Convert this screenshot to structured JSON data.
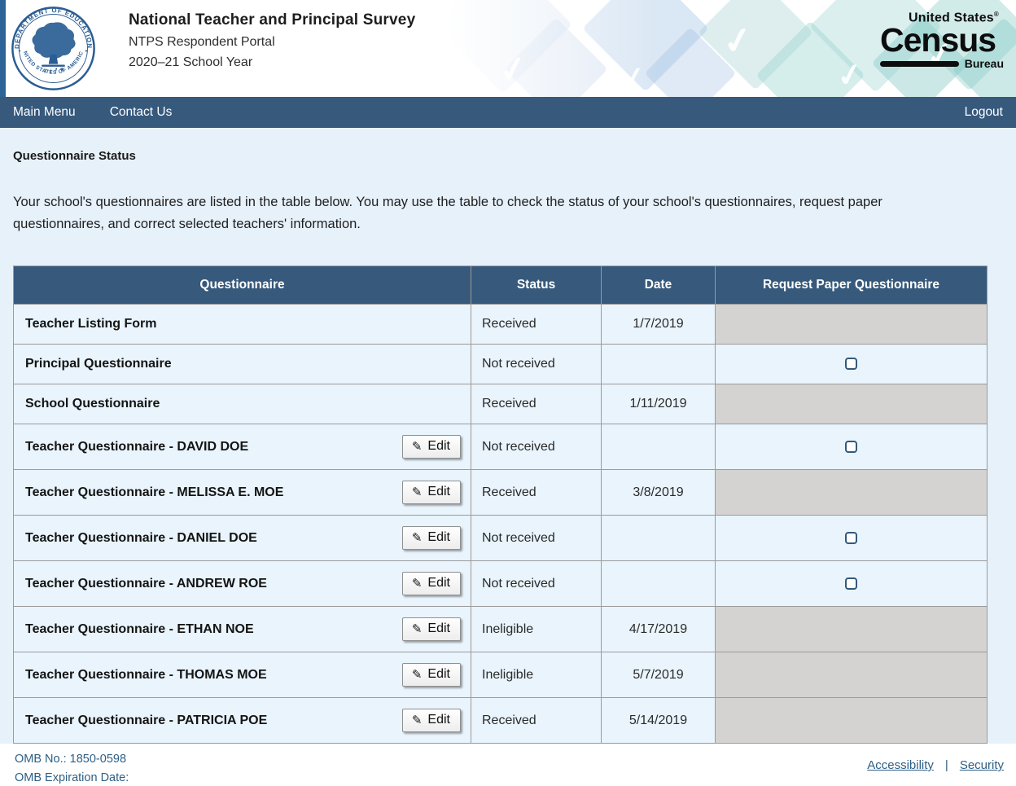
{
  "header": {
    "seal": {
      "top_text": "DEPARTMENT OF EDUCATION",
      "bottom_text": "UNITED STATES OF AMERICA",
      "star_glyph": "✦"
    },
    "title": "National Teacher and Principal Survey",
    "subtitle": "NTPS Respondent Portal",
    "school_year": "2020–21 School Year",
    "census_logo": {
      "line1": "United States",
      "reg": "®",
      "line2": "Census",
      "line3": "Bureau"
    },
    "pattern": {
      "check_glyph": "✓"
    }
  },
  "nav": {
    "items": [
      {
        "label": "Main Menu"
      },
      {
        "label": "Contact Us"
      }
    ],
    "logout_label": "Logout"
  },
  "main": {
    "heading": "Questionnaire Status",
    "intro": "Your school's questionnaires are listed in the table below. You may use the table to check the status of your school's questionnaires, request paper questionnaires, and correct selected teachers' information."
  },
  "table": {
    "columns": [
      "Questionnaire",
      "Status",
      "Date",
      "Request Paper Questionnaire"
    ],
    "edit_label": "Edit",
    "edit_icon_glyph": "✎",
    "rows": [
      {
        "name": "Teacher Listing Form",
        "has_edit": false,
        "status": "Received",
        "date": "1/7/2019",
        "request": "none"
      },
      {
        "name": "Principal Questionnaire",
        "has_edit": false,
        "status": "Not received",
        "date": "",
        "request": "checkbox"
      },
      {
        "name": "School Questionnaire",
        "has_edit": false,
        "status": "Received",
        "date": "1/11/2019",
        "request": "none"
      },
      {
        "name": "Teacher Questionnaire - DAVID DOE",
        "has_edit": true,
        "status": "Not received",
        "date": "",
        "request": "checkbox"
      },
      {
        "name": "Teacher Questionnaire - MELISSA E. MOE",
        "has_edit": true,
        "status": "Received",
        "date": "3/8/2019",
        "request": "none"
      },
      {
        "name": "Teacher Questionnaire - DANIEL DOE",
        "has_edit": true,
        "status": "Not received",
        "date": "",
        "request": "checkbox"
      },
      {
        "name": "Teacher Questionnaire - ANDREW ROE",
        "has_edit": true,
        "status": "Not received",
        "date": "",
        "request": "checkbox"
      },
      {
        "name": "Teacher Questionnaire - ETHAN NOE",
        "has_edit": true,
        "status": "Ineligible",
        "date": "4/17/2019",
        "request": "none"
      },
      {
        "name": "Teacher Questionnaire - THOMAS MOE",
        "has_edit": true,
        "status": "Ineligible",
        "date": "5/7/2019",
        "request": "none"
      },
      {
        "name": "Teacher Questionnaire - PATRICIA POE",
        "has_edit": true,
        "status": "Received",
        "date": "5/14/2019",
        "request": "none"
      }
    ]
  },
  "footer": {
    "omb_no": "OMB No.: 1850-0598",
    "omb_exp": "OMB Expiration Date:",
    "links": [
      {
        "label": "Accessibility"
      },
      {
        "label": "Security"
      }
    ],
    "separator": "|"
  },
  "colors": {
    "navy": "#36597c",
    "page_bg": "#e7f1fa",
    "row_bg": "#e9f4fc",
    "gray_cell": "#d4d3d1",
    "seal_blue": "#2a5d94",
    "left_strip": "#2e6397",
    "footer_text": "#2d5f85"
  }
}
